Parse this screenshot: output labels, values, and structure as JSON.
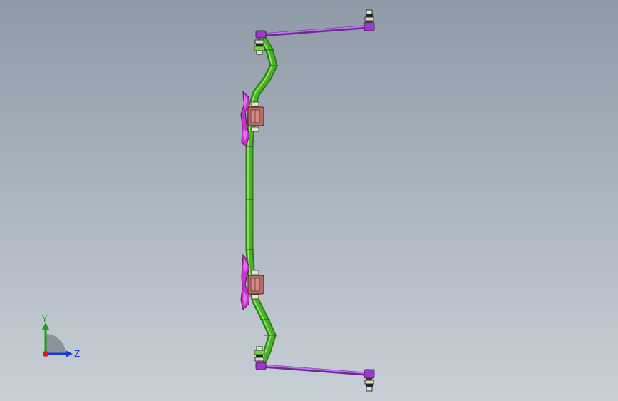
{
  "view": {
    "background_top": "#8f9aa7",
    "background_bottom": "#c8cfd6"
  },
  "model": {
    "bar_color": "#3aa61f",
    "bar_highlight": "#9ce06a",
    "link_color": "#a040d0",
    "bracket_color": "#b02cc0",
    "bushing_color": "#b0706a"
  },
  "triad": {
    "y_label": "Y",
    "z_label": "Z",
    "y_color": "#18a018",
    "z_color": "#1838d8",
    "origin_color": "#e01818"
  }
}
